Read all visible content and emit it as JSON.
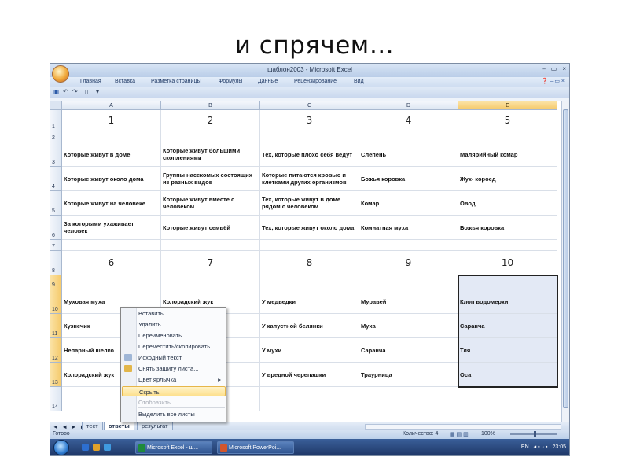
{
  "slide": {
    "title": "и спрячем…"
  },
  "excel": {
    "title": "шаблон2003 - Microsoft Excel",
    "window_controls": [
      "–",
      "▭",
      "×"
    ],
    "ribbon_tabs": [
      "Главная",
      "Вставка",
      "Разметка страницы",
      "Формулы",
      "Данные",
      "Рецензирование",
      "Вид"
    ],
    "columns": [
      "A",
      "B",
      "C",
      "D",
      "E"
    ],
    "rows": [
      {
        "num": "1",
        "cells": [
          "1",
          "2",
          "3",
          "4",
          "5"
        ]
      },
      {
        "num": "2",
        "cells": [
          "",
          "",
          "",
          "",
          ""
        ]
      },
      {
        "num": "3",
        "cells": [
          "Которые живут в доме",
          "Которые живут большими скоплениями",
          "Тех, которые плохо себя ведут",
          "Слепень",
          "Малярийный комар"
        ]
      },
      {
        "num": "4",
        "cells": [
          "Которые живут около дома",
          "Группы насекомых состоящих из разных видов",
          "Которые питаются кровью и клетками других организмов",
          "Божья коровка",
          "Жук- короед"
        ]
      },
      {
        "num": "5",
        "cells": [
          "Которые живут на человеке",
          "Которые живут вместе с человеком",
          "Тех, которые живут в доме рядом с человеком",
          "Комар",
          "Овод"
        ]
      },
      {
        "num": "6",
        "cells": [
          "За которыми ухаживает человек",
          "Которые живут семьёй",
          "Тех, которые живут около дома",
          "Комнатная муха",
          "Божья коровка"
        ]
      },
      {
        "num": "7",
        "cells": [
          "",
          "",
          "",
          "",
          ""
        ]
      },
      {
        "num": "8",
        "cells": [
          "6",
          "7",
          "8",
          "9",
          "10"
        ]
      },
      {
        "num": "9",
        "cells": [
          "",
          "",
          "",
          "",
          ""
        ]
      },
      {
        "num": "10",
        "cells": [
          "Муховая муха",
          "Колорадский жук",
          "У медведки",
          "Муравей",
          "Клоп водомерки"
        ]
      },
      {
        "num": "11",
        "cells": [
          "Кузнечик",
          "",
          "У капустной белянки",
          "Муха",
          "Саранча"
        ]
      },
      {
        "num": "12",
        "cells": [
          "Непарный шелко",
          "",
          "У мухи",
          "Саранча",
          "Тля"
        ]
      },
      {
        "num": "13",
        "cells": [
          "Колорадский жук",
          "",
          "У вредной черепашки",
          "Траурница",
          "Оса"
        ]
      },
      {
        "num": "14",
        "cells": [
          "",
          "",
          "",
          "",
          ""
        ]
      }
    ],
    "sheet_tabs": {
      "nav": "◄ ◄ ► ►",
      "tabs": [
        "тест",
        "ответы",
        "результат"
      ]
    },
    "status": {
      "ready": "Готово",
      "count": "Количество: 4",
      "zoom": "100%"
    },
    "context_menu": [
      {
        "label": "Вставить...",
        "enabled": true,
        "icon": ""
      },
      {
        "label": "Удалить",
        "enabled": true,
        "icon": ""
      },
      {
        "label": "Переименовать",
        "enabled": true,
        "icon": ""
      },
      {
        "label": "Переместить/скопировать...",
        "enabled": true,
        "icon": ""
      },
      {
        "label": "Исходный текст",
        "enabled": true,
        "icon": "view-code-icon"
      },
      {
        "label": "Снять защиту листа...",
        "enabled": true,
        "icon": "unprotect-sheet-icon"
      },
      {
        "label": "Цвет ярлычка",
        "enabled": true,
        "icon": "",
        "submenu": true
      },
      {
        "label": "Скрыть",
        "enabled": true,
        "highlighted": true,
        "icon": ""
      },
      {
        "label": "Отобразить...",
        "enabled": false,
        "icon": ""
      },
      {
        "label": "Выделить все листы",
        "enabled": true,
        "icon": ""
      }
    ]
  },
  "taskbar": {
    "buttons": [
      "Microsoft Excel - ш...",
      "Microsoft PowerPoi..."
    ],
    "lang": "EN",
    "clock": "23:05"
  }
}
